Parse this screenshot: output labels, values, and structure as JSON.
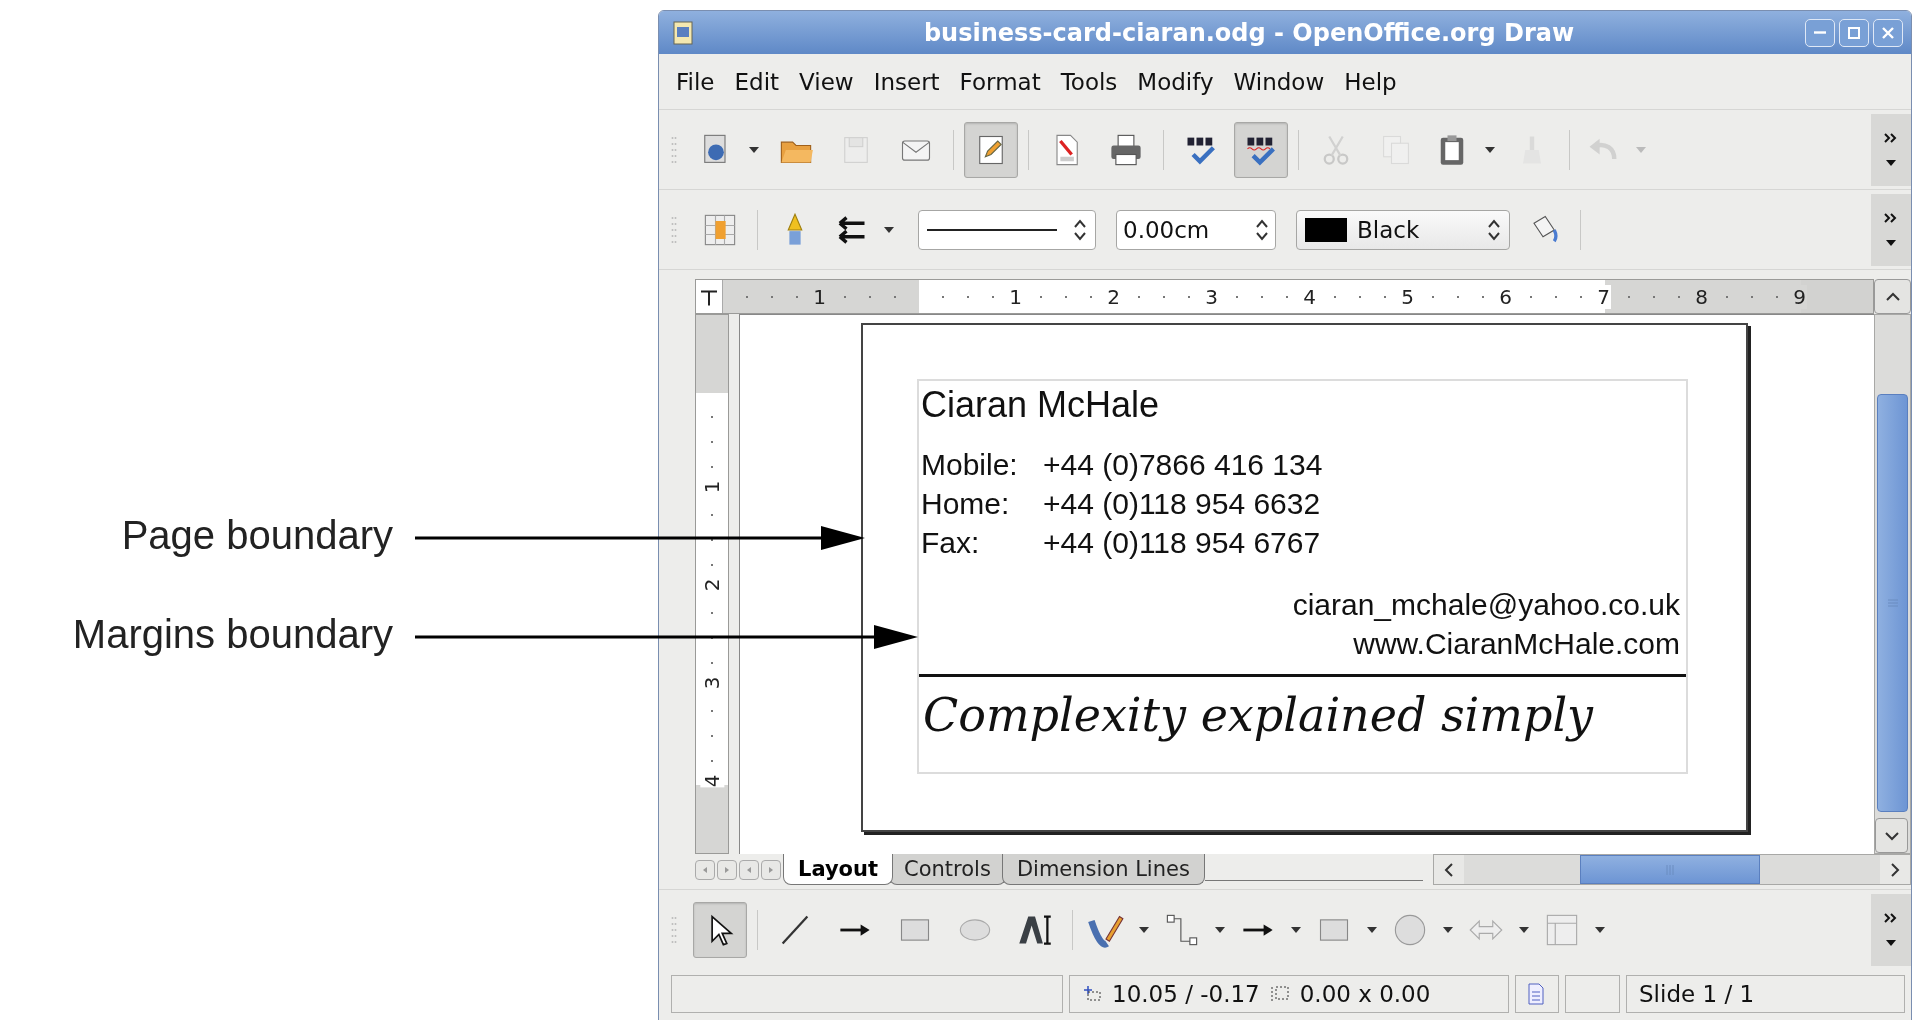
{
  "annotations": [
    {
      "label": "Page boundary",
      "kind": "page"
    },
    {
      "label": "Margins boundary",
      "kind": "margins"
    }
  ],
  "window": {
    "title": "business-card-ciaran.odg - OpenOffice.org Draw"
  },
  "menu": [
    {
      "label": "File"
    },
    {
      "label": "Edit"
    },
    {
      "label": "View"
    },
    {
      "label": "Insert"
    },
    {
      "label": "Format"
    },
    {
      "label": "Tools"
    },
    {
      "label": "Modify"
    },
    {
      "label": "Window"
    },
    {
      "label": "Help"
    }
  ],
  "toolbar_1": [
    {
      "kind": "export",
      "pressed": false,
      "disabled": false,
      "dropdown": true
    },
    {
      "kind": "open",
      "pressed": false,
      "disabled": false,
      "dropdown": false
    },
    {
      "kind": "save",
      "pressed": false,
      "disabled": true,
      "dropdown": false
    },
    {
      "kind": "email",
      "pressed": false,
      "disabled": false,
      "dropdown": false
    },
    {
      "kind": "separator"
    },
    {
      "kind": "edit",
      "pressed": true,
      "disabled": false,
      "dropdown": false
    },
    {
      "kind": "separator"
    },
    {
      "kind": "pdf",
      "pressed": false,
      "disabled": false,
      "dropdown": false
    },
    {
      "kind": "print",
      "pressed": false,
      "disabled": false,
      "dropdown": false
    },
    {
      "kind": "separator"
    },
    {
      "kind": "spellcheck",
      "pressed": false,
      "disabled": false,
      "dropdown": false
    },
    {
      "kind": "autospell",
      "pressed": true,
      "disabled": false,
      "dropdown": false
    },
    {
      "kind": "separator"
    },
    {
      "kind": "cut",
      "pressed": false,
      "disabled": true,
      "dropdown": false
    },
    {
      "kind": "copy",
      "pressed": false,
      "disabled": true,
      "dropdown": false
    },
    {
      "kind": "paste",
      "pressed": false,
      "disabled": false,
      "dropdown": true
    },
    {
      "kind": "clone",
      "pressed": false,
      "disabled": true,
      "dropdown": false
    },
    {
      "kind": "separator"
    },
    {
      "kind": "undo",
      "pressed": false,
      "disabled": true,
      "dropdown": true
    }
  ],
  "toolbar_2": [
    {
      "kind": "area",
      "pressed": false,
      "disabled": false,
      "dropdown": false
    },
    {
      "kind": "separator"
    },
    {
      "kind": "pen",
      "pressed": false,
      "disabled": false,
      "dropdown": false
    },
    {
      "kind": "arrow-style",
      "pressed": false,
      "disabled": false,
      "dropdown": true
    },
    {
      "kind": "line-combo"
    },
    {
      "kind": "width-field",
      "value": "0.00cm"
    },
    {
      "kind": "color-combo",
      "value": "Black",
      "color": "#000000"
    },
    {
      "kind": "bucket",
      "pressed": false,
      "disabled": false,
      "dropdown": false
    },
    {
      "kind": "separator"
    }
  ],
  "horizontal_ruler": [
    {
      "label": "1",
      "margin": true
    },
    {
      "label": "1",
      "margin": false
    },
    {
      "label": "2",
      "margin": false
    },
    {
      "label": "3",
      "margin": false
    },
    {
      "label": "4",
      "margin": false
    },
    {
      "label": "5",
      "margin": false
    },
    {
      "label": "6",
      "margin": false
    },
    {
      "label": "7",
      "margin": false
    },
    {
      "label": "8",
      "margin": true
    },
    {
      "label": "9",
      "margin": true
    }
  ],
  "vertical_ruler": [
    {
      "label": "1"
    },
    {
      "label": "2"
    },
    {
      "label": "3"
    },
    {
      "label": "4"
    }
  ],
  "card": {
    "name": "Ciaran McHale",
    "phones": [
      {
        "label": "Mobile:",
        "value": "+44 (0)7866 416 134"
      },
      {
        "label": "Home:",
        "value": "+44 (0)118 954 6632"
      },
      {
        "label": "Fax:",
        "value": "+44 (0)118 954 6767"
      }
    ],
    "email": "ciaran_mchale@yahoo.co.uk",
    "website": "www.CiaranMcHale.com",
    "tagline": "Complexity explained simply"
  },
  "sheet_tabs": [
    {
      "label": "Layout",
      "selected": true
    },
    {
      "label": "Controls",
      "selected": false
    },
    {
      "label": "Dimension Lines",
      "selected": false
    }
  ],
  "drawing_toolbar": [
    {
      "kind": "select",
      "pressed": true,
      "disabled": false,
      "dropdown": false
    },
    {
      "kind": "separator"
    },
    {
      "kind": "line",
      "pressed": false,
      "disabled": false,
      "dropdown": false
    },
    {
      "kind": "arrow-line",
      "pressed": false,
      "disabled": false,
      "dropdown": false
    },
    {
      "kind": "rect",
      "pressed": false,
      "disabled": false,
      "dropdown": false
    },
    {
      "kind": "ellipse",
      "pressed": false,
      "disabled": false,
      "dropdown": false
    },
    {
      "kind": "fontwork",
      "pressed": false,
      "disabled": false,
      "dropdown": false
    },
    {
      "kind": "separator"
    },
    {
      "kind": "curve",
      "pressed": false,
      "disabled": false,
      "dropdown": true
    },
    {
      "kind": "connector",
      "pressed": false,
      "disabled": false,
      "dropdown": true
    },
    {
      "kind": "arrow-line",
      "pressed": false,
      "disabled": false,
      "dropdown": true
    },
    {
      "kind": "rect",
      "pressed": false,
      "disabled": false,
      "dropdown": true
    },
    {
      "kind": "symbol",
      "pressed": false,
      "disabled": false,
      "dropdown": true
    },
    {
      "kind": "block-arrows",
      "pressed": false,
      "disabled": false,
      "dropdown": true
    },
    {
      "kind": "flowchart",
      "pressed": false,
      "disabled": false,
      "dropdown": true
    }
  ],
  "status_bar": {
    "position": "10.05 / -0.17",
    "size": "0.00 x 0.00",
    "slide": "Slide 1 / 1"
  }
}
